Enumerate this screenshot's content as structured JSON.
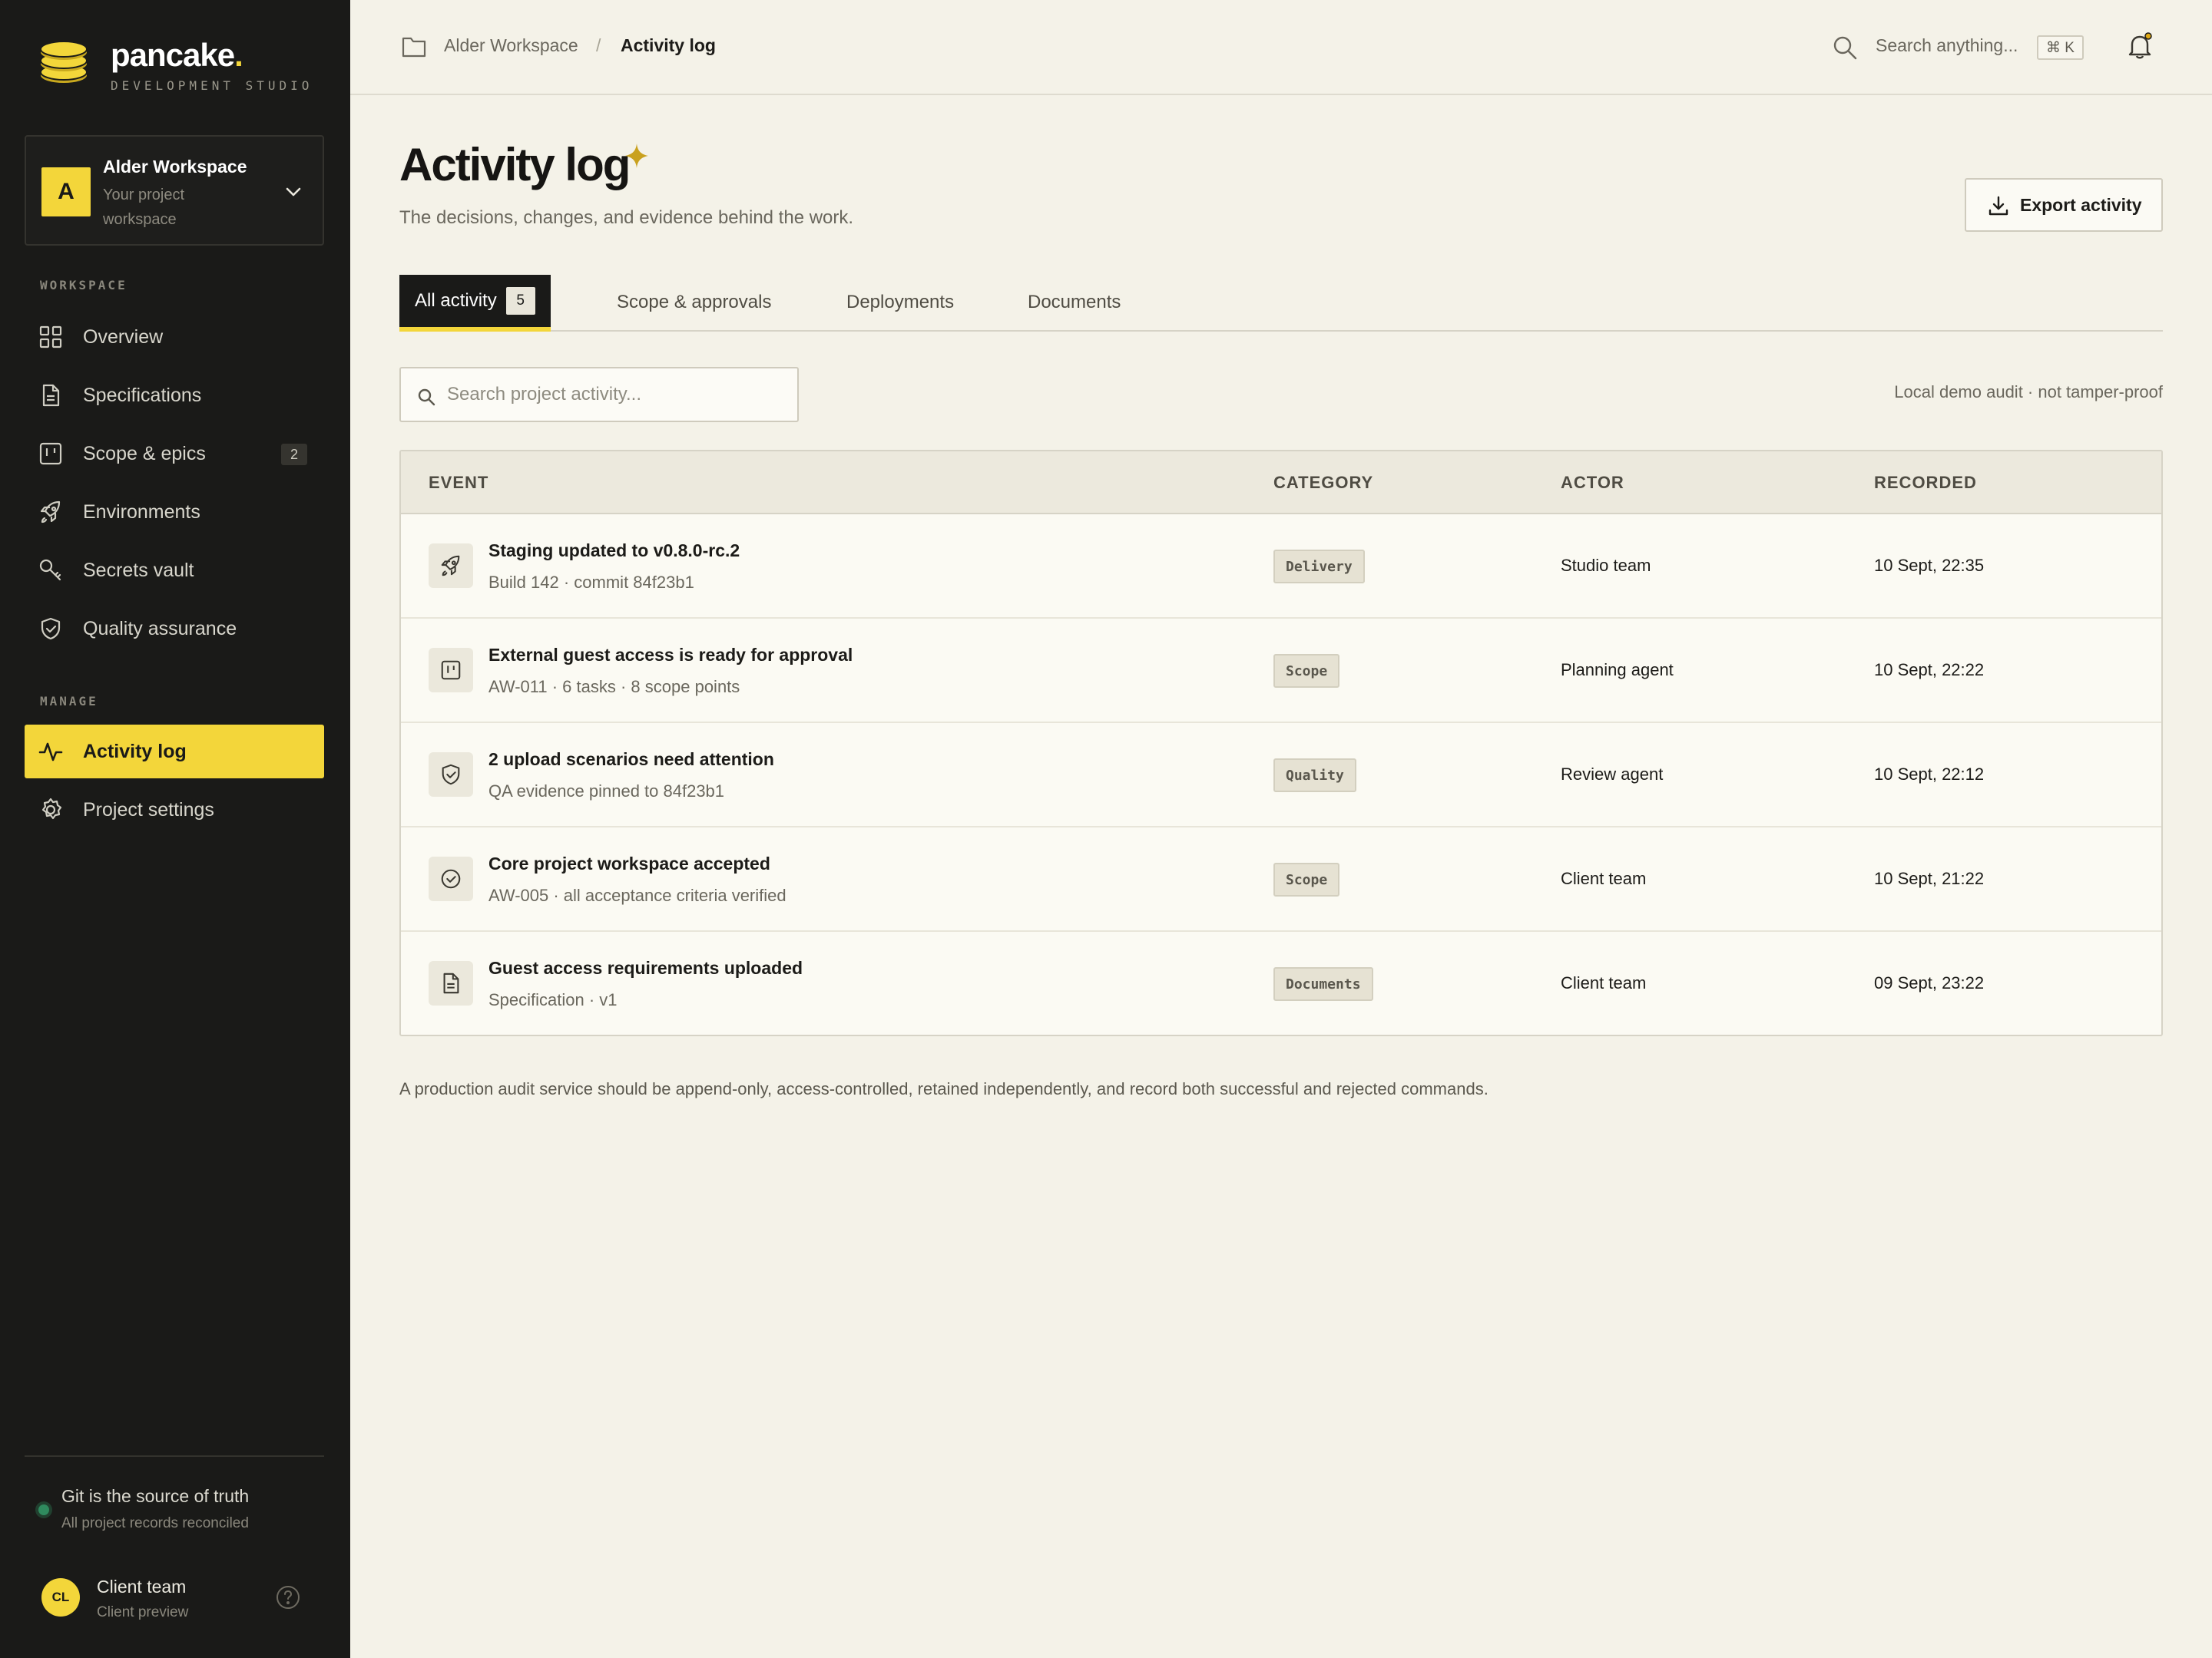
{
  "brand": {
    "name": "pancake",
    "dot": ".",
    "tagline": "DEVELOPMENT STUDIO",
    "accent_color": "#f3d63a"
  },
  "workspace": {
    "initial": "A",
    "name": "Alder Workspace",
    "subtitle": "Your project workspace"
  },
  "sidebar": {
    "section_workspace": "WORKSPACE",
    "section_manage": "MANAGE",
    "items": [
      {
        "label": "Overview",
        "icon": "grid-icon"
      },
      {
        "label": "Specifications",
        "icon": "document-icon"
      },
      {
        "label": "Scope & epics",
        "icon": "kanban-icon",
        "badge": "2"
      },
      {
        "label": "Environments",
        "icon": "rocket-icon"
      },
      {
        "label": "Secrets vault",
        "icon": "key-icon"
      },
      {
        "label": "Quality assurance",
        "icon": "shield-check-icon"
      }
    ],
    "manage_items": [
      {
        "label": "Activity log",
        "icon": "activity-icon",
        "active": true
      },
      {
        "label": "Project settings",
        "icon": "gear-icon"
      }
    ],
    "git_status": {
      "title": "Git is the source of truth",
      "subtitle": "All project records reconciled",
      "status_color": "#2f8a5e"
    },
    "user": {
      "initials": "CL",
      "name": "Client team",
      "role": "Client preview"
    }
  },
  "topbar": {
    "breadcrumb": [
      "Alder Workspace",
      "Activity log"
    ],
    "separator": "/",
    "search_placeholder": "Search anything...",
    "shortcut": "⌘ K"
  },
  "page": {
    "title": "Activity log",
    "subtitle": "The decisions, changes, and evidence behind the work.",
    "export_label": "Export activity"
  },
  "tabs": [
    {
      "label": "All activity",
      "count": "5",
      "active": true
    },
    {
      "label": "Scope & approvals"
    },
    {
      "label": "Deployments"
    },
    {
      "label": "Documents"
    }
  ],
  "filter": {
    "search_placeholder": "Search project activity...",
    "audit_note": "Local demo audit · not tamper-proof"
  },
  "table": {
    "columns": [
      "EVENT",
      "CATEGORY",
      "ACTOR",
      "RECORDED"
    ],
    "rows": [
      {
        "icon": "rocket-icon",
        "title": "Staging updated to v0.8.0-rc.2",
        "detail": "Build 142 · commit 84f23b1",
        "category": "Delivery",
        "actor": "Studio team",
        "recorded": "10 Sept, 22:35"
      },
      {
        "icon": "kanban-icon",
        "title": "External guest access is ready for approval",
        "detail": "AW-011 · 6 tasks · 8 scope points",
        "category": "Scope",
        "actor": "Planning agent",
        "recorded": "10 Sept, 22:22"
      },
      {
        "icon": "shield-check-icon",
        "title": "2 upload scenarios need attention",
        "detail": "QA evidence pinned to 84f23b1",
        "category": "Quality",
        "actor": "Review agent",
        "recorded": "10 Sept, 22:12"
      },
      {
        "icon": "check-circle-icon",
        "title": "Core project workspace accepted",
        "detail": "AW-005 · all acceptance criteria verified",
        "category": "Scope",
        "actor": "Client team",
        "recorded": "10 Sept, 21:22"
      },
      {
        "icon": "document-icon",
        "title": "Guest access requirements uploaded",
        "detail": "Specification · v1",
        "category": "Documents",
        "actor": "Client team",
        "recorded": "09 Sept, 23:22"
      }
    ]
  },
  "footnote": "A production audit service should be append-only, access-controlled, retained independently, and record both successful and rejected commands."
}
